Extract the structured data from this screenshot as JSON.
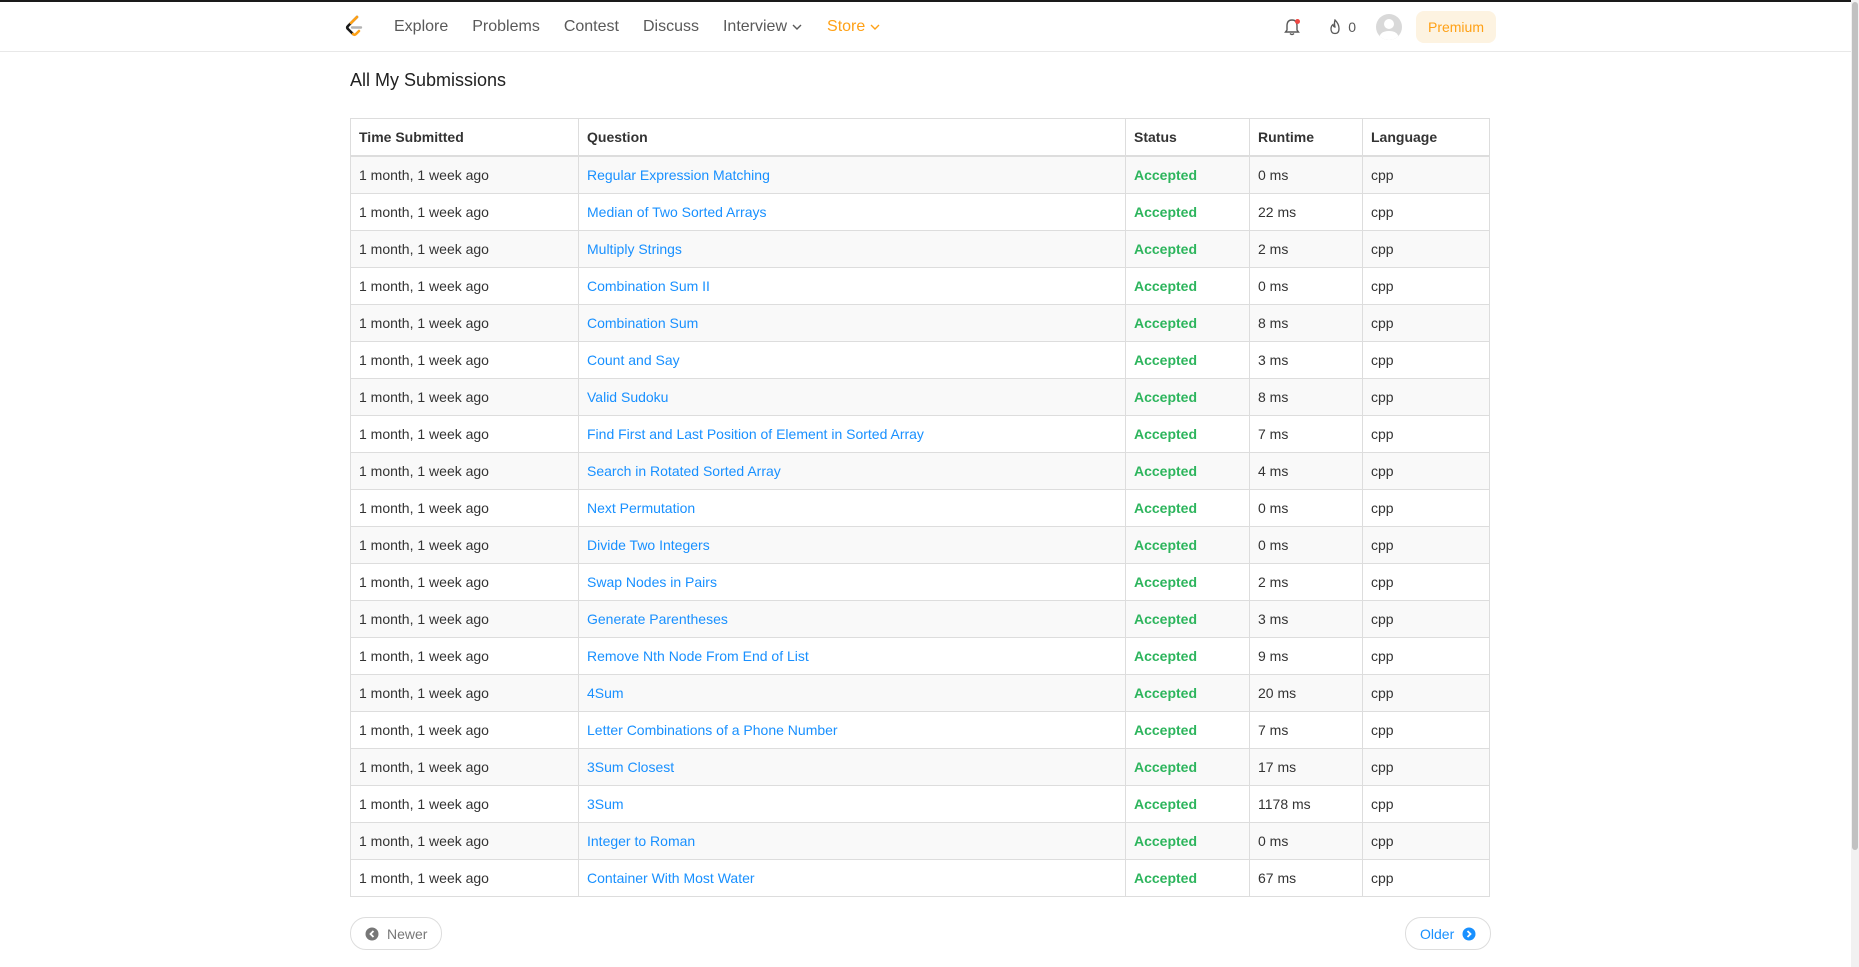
{
  "nav": {
    "links": [
      "Explore",
      "Problems",
      "Contest",
      "Discuss",
      "Interview"
    ],
    "store_label": "Store",
    "streak_count": "0",
    "premium_label": "Premium",
    "accent_color": "#ffa116"
  },
  "page": {
    "title": "All My Submissions"
  },
  "table": {
    "headers": [
      "Time Submitted",
      "Question",
      "Status",
      "Runtime",
      "Language"
    ],
    "rows": [
      {
        "time": "1 month, 1 week ago",
        "question": "Regular Expression Matching",
        "status": "Accepted",
        "runtime": "0 ms",
        "language": "cpp"
      },
      {
        "time": "1 month, 1 week ago",
        "question": "Median of Two Sorted Arrays",
        "status": "Accepted",
        "runtime": "22 ms",
        "language": "cpp"
      },
      {
        "time": "1 month, 1 week ago",
        "question": "Multiply Strings",
        "status": "Accepted",
        "runtime": "2 ms",
        "language": "cpp"
      },
      {
        "time": "1 month, 1 week ago",
        "question": "Combination Sum II",
        "status": "Accepted",
        "runtime": "0 ms",
        "language": "cpp"
      },
      {
        "time": "1 month, 1 week ago",
        "question": "Combination Sum",
        "status": "Accepted",
        "runtime": "8 ms",
        "language": "cpp"
      },
      {
        "time": "1 month, 1 week ago",
        "question": "Count and Say",
        "status": "Accepted",
        "runtime": "3 ms",
        "language": "cpp"
      },
      {
        "time": "1 month, 1 week ago",
        "question": "Valid Sudoku",
        "status": "Accepted",
        "runtime": "8 ms",
        "language": "cpp"
      },
      {
        "time": "1 month, 1 week ago",
        "question": "Find First and Last Position of Element in Sorted Array",
        "status": "Accepted",
        "runtime": "7 ms",
        "language": "cpp"
      },
      {
        "time": "1 month, 1 week ago",
        "question": "Search in Rotated Sorted Array",
        "status": "Accepted",
        "runtime": "4 ms",
        "language": "cpp"
      },
      {
        "time": "1 month, 1 week ago",
        "question": "Next Permutation",
        "status": "Accepted",
        "runtime": "0 ms",
        "language": "cpp"
      },
      {
        "time": "1 month, 1 week ago",
        "question": "Divide Two Integers",
        "status": "Accepted",
        "runtime": "0 ms",
        "language": "cpp"
      },
      {
        "time": "1 month, 1 week ago",
        "question": "Swap Nodes in Pairs",
        "status": "Accepted",
        "runtime": "2 ms",
        "language": "cpp"
      },
      {
        "time": "1 month, 1 week ago",
        "question": "Generate Parentheses",
        "status": "Accepted",
        "runtime": "3 ms",
        "language": "cpp"
      },
      {
        "time": "1 month, 1 week ago",
        "question": "Remove Nth Node From End of List",
        "status": "Accepted",
        "runtime": "9 ms",
        "language": "cpp"
      },
      {
        "time": "1 month, 1 week ago",
        "question": "4Sum",
        "status": "Accepted",
        "runtime": "20 ms",
        "language": "cpp"
      },
      {
        "time": "1 month, 1 week ago",
        "question": "Letter Combinations of a Phone Number",
        "status": "Accepted",
        "runtime": "7 ms",
        "language": "cpp"
      },
      {
        "time": "1 month, 1 week ago",
        "question": "3Sum Closest",
        "status": "Accepted",
        "runtime": "17 ms",
        "language": "cpp"
      },
      {
        "time": "1 month, 1 week ago",
        "question": "3Sum",
        "status": "Accepted",
        "runtime": "1178 ms",
        "language": "cpp"
      },
      {
        "time": "1 month, 1 week ago",
        "question": "Integer to Roman",
        "status": "Accepted",
        "runtime": "0 ms",
        "language": "cpp"
      },
      {
        "time": "1 month, 1 week ago",
        "question": "Container With Most Water",
        "status": "Accepted",
        "runtime": "67 ms",
        "language": "cpp"
      }
    ]
  },
  "pager": {
    "newer_label": "Newer",
    "older_label": "Older"
  },
  "colors": {
    "link": "#1890ff",
    "accepted": "#2db55d",
    "premium_bg": "#fdf3e1"
  }
}
